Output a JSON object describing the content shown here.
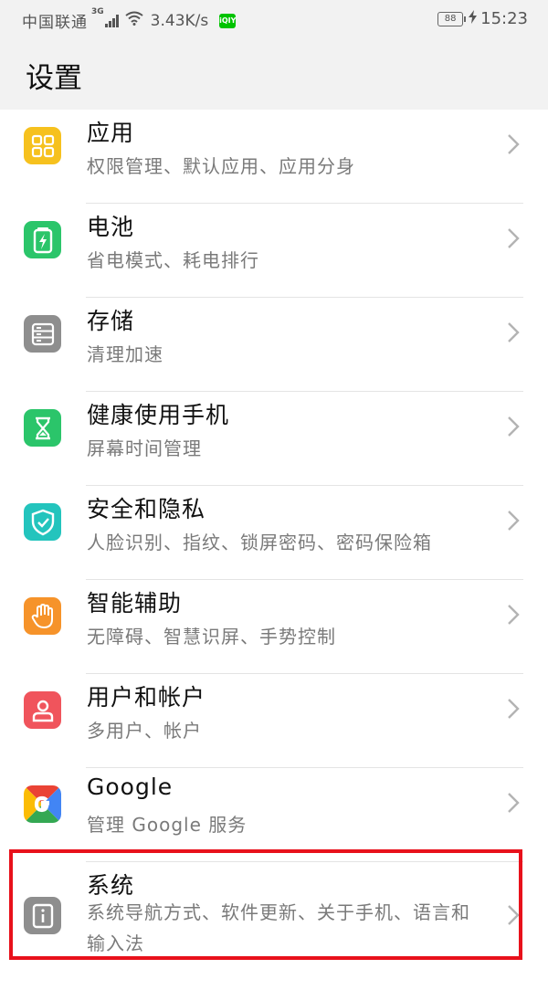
{
  "status_bar": {
    "carrier": "中国联通",
    "network_type": "3G",
    "speed": "3.43K/s",
    "app_badge": "iQIY",
    "battery": "88",
    "time": "15:23"
  },
  "header": {
    "title": "设置"
  },
  "settings_items": [
    {
      "title": "应用",
      "subtitle": "权限管理、默认应用、应用分身",
      "icon": "apps-icon",
      "color": "#f6c11e"
    },
    {
      "title": "电池",
      "subtitle": "省电模式、耗电排行",
      "icon": "battery-icon",
      "color": "#2bc56a"
    },
    {
      "title": "存储",
      "subtitle": "清理加速",
      "icon": "storage-icon",
      "color": "#8e8e8e"
    },
    {
      "title": "健康使用手机",
      "subtitle": "屏幕时间管理",
      "icon": "hourglass-icon",
      "color": "#2bc56a"
    },
    {
      "title": "安全和隐私",
      "subtitle": "人脸识别、指纹、锁屏密码、密码保险箱",
      "icon": "shield-icon",
      "color": "#23c4bd"
    },
    {
      "title": "智能辅助",
      "subtitle": "无障碍、智慧识屏、手势控制",
      "icon": "hand-icon",
      "color": "#f6932a"
    },
    {
      "title": "用户和帐户",
      "subtitle": "多用户、帐户",
      "icon": "user-icon",
      "color": "#f0545c"
    },
    {
      "title": "Google",
      "subtitle": "管理 Google 服务",
      "icon": "google-icon",
      "color": "#4285f4"
    },
    {
      "title": "系统",
      "subtitle": "系统导航方式、软件更新、关于手机、语言和输入法",
      "icon": "system-info-icon",
      "color": "#8e8e8e"
    }
  ],
  "highlight_color": "#e8111b"
}
